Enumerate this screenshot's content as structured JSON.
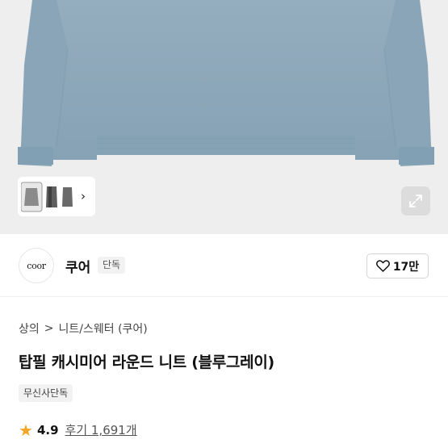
{
  "product_image": {
    "alt": "",
    "thumbnail_next_icon": "chevron-right-icon",
    "expand_icon": "expand-icon"
  },
  "brand": {
    "logo_text": "coor",
    "name": "쿠어",
    "badge": "단독",
    "like_count": "17만"
  },
  "breadcrumb": {
    "items": [
      "상의",
      "니트/스웨터 (쿠어)"
    ],
    "separator": ">"
  },
  "product": {
    "title": "탑필 캐시미어 라운드 니트 (블루그레이)",
    "tag": "무신사단독",
    "rating": "4.9",
    "reviews_label": "후기 1,691개"
  },
  "colors": {
    "accent_star": "#f5a623",
    "sweater": "#8fa9bb",
    "hero_bg": "#eeeeee"
  }
}
